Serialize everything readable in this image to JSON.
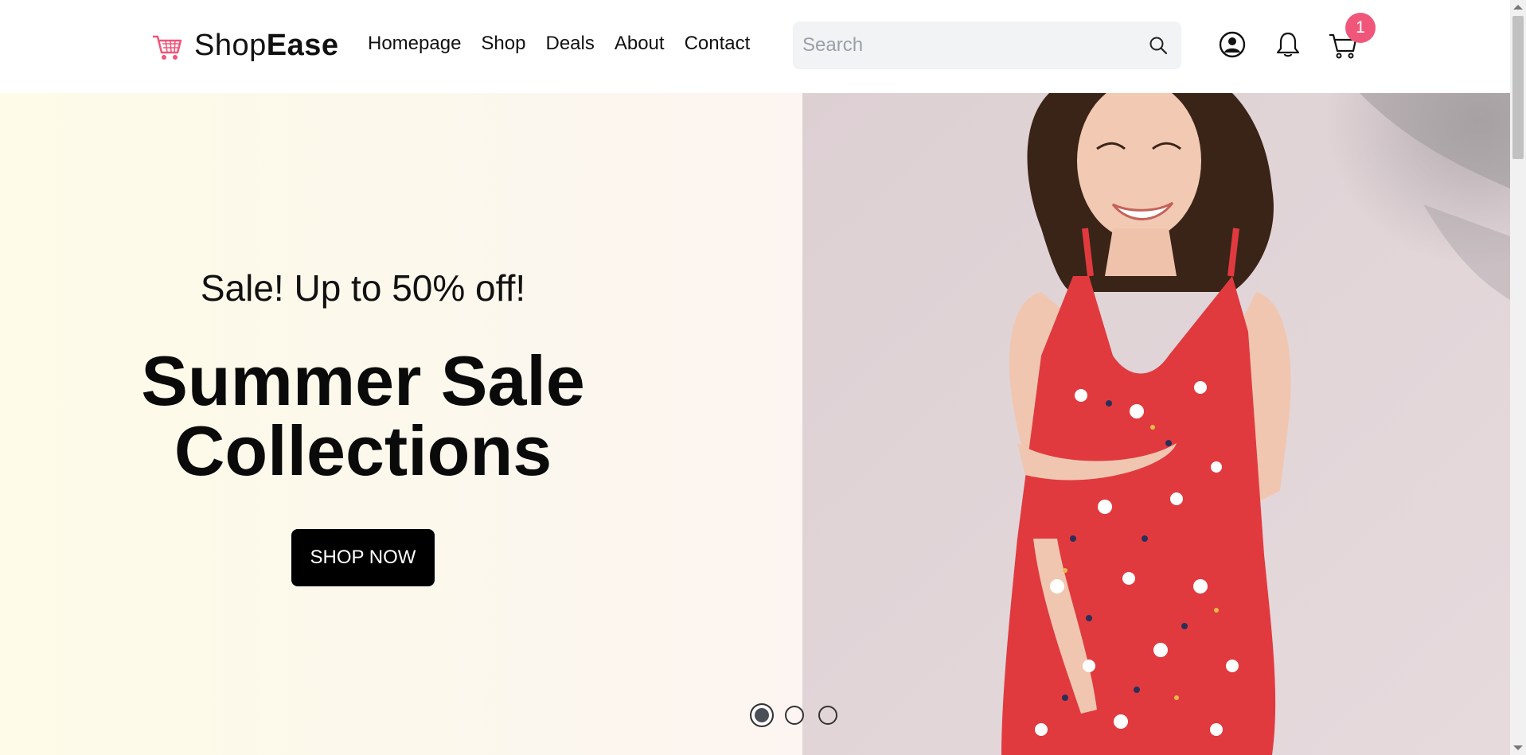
{
  "brand": {
    "name_light": "Shop",
    "name_bold": "Ease",
    "logo_icon": "shopping-cart-icon",
    "accent": "#f0567a"
  },
  "nav": {
    "items": [
      "Homepage",
      "Shop",
      "Deals",
      "About",
      "Contact"
    ]
  },
  "search": {
    "placeholder": "Search",
    "value": ""
  },
  "header_icons": {
    "user": "user-circle-icon",
    "bell": "bell-icon",
    "cart": "cart-icon",
    "cart_count": "1"
  },
  "hero": {
    "subtitle": "Sale! Up to 50% off!",
    "title_line1": "Summer Sale",
    "title_line2": "Collections",
    "cta_label": "SHOP NOW",
    "carousel_slides": 3,
    "carousel_active": 1
  }
}
